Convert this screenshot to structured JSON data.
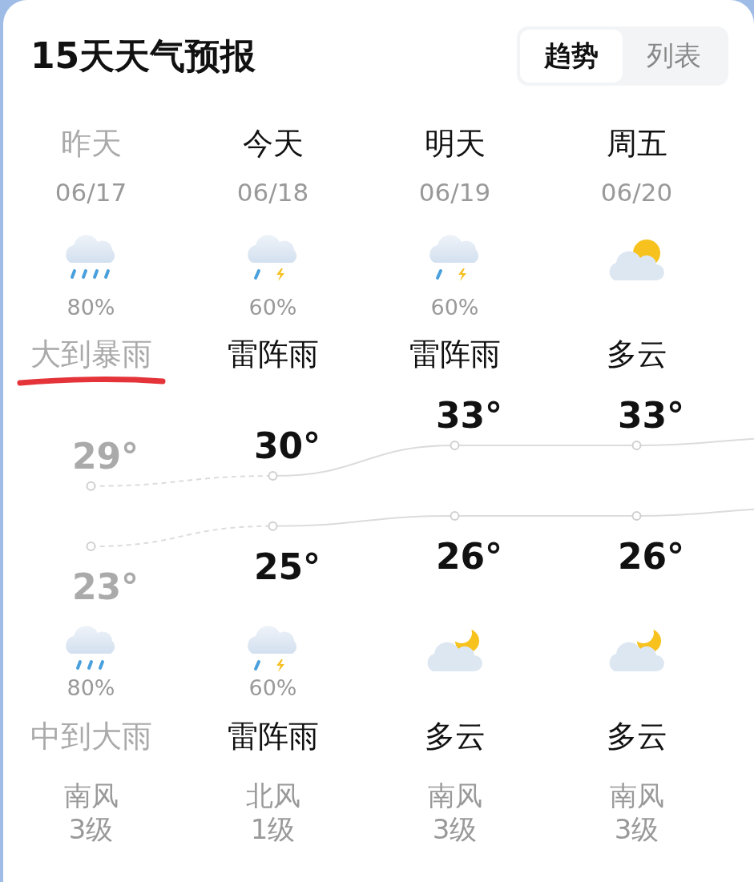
{
  "title": "15天天气预报",
  "tabs": [
    {
      "label": "趋势",
      "selected": true
    },
    {
      "label": "列表",
      "selected": false
    }
  ],
  "days": [
    {
      "name": "昨天",
      "date": "06/17",
      "past": true,
      "high": "29°",
      "low": "23°",
      "wind": "南风",
      "wind_level": "3级",
      "day": {
        "kind": "heavy-rain",
        "precip": "80%",
        "condition": "大到暴雨",
        "underlined": true
      },
      "night": {
        "kind": "moderate-rain",
        "precip": "80%",
        "condition": "中到大雨"
      }
    },
    {
      "name": "今天",
      "date": "06/18",
      "past": false,
      "high": "30°",
      "low": "25°",
      "wind": "北风",
      "wind_level": "1级",
      "day": {
        "kind": "thunder-shower",
        "precip": "60%",
        "condition": "雷阵雨",
        "underlined": false
      },
      "night": {
        "kind": "thunder-shower",
        "precip": "60%",
        "condition": "雷阵雨"
      }
    },
    {
      "name": "明天",
      "date": "06/19",
      "past": false,
      "high": "33°",
      "low": "26°",
      "wind": "南风",
      "wind_level": "3级",
      "day": {
        "kind": "thunder-shower",
        "precip": "60%",
        "condition": "雷阵雨",
        "underlined": false
      },
      "night": {
        "kind": "partly-cloudy-night",
        "condition": "多云"
      }
    },
    {
      "name": "周五",
      "date": "06/20",
      "past": false,
      "high": "33°",
      "low": "26°",
      "wind": "南风",
      "wind_level": "3级",
      "day": {
        "kind": "partly-cloudy-day",
        "condition": "多云",
        "underlined": false
      },
      "night": {
        "kind": "partly-cloudy-night",
        "condition": "多云"
      }
    }
  ]
}
